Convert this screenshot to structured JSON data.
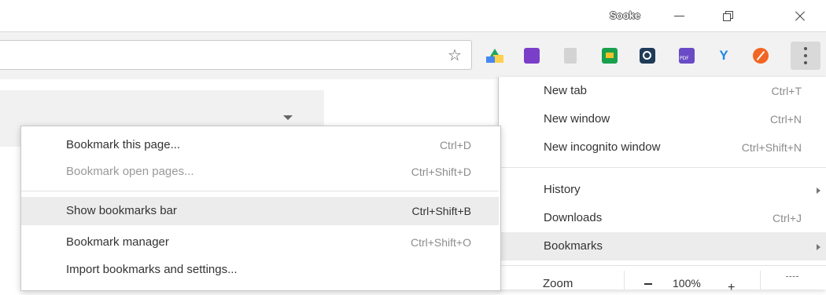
{
  "window": {
    "profile_name": "Sooke"
  },
  "toolbar": {
    "extensions": [
      "google-drive-icon",
      "puzzle-extension-icon",
      "grey-extension-icon",
      "google-classroom-icon",
      "camera-extension-icon",
      "pdf-extension-icon",
      "y-extension-icon",
      "orange-extension-icon"
    ]
  },
  "main_menu": {
    "items": [
      {
        "label": "New tab",
        "shortcut": "Ctrl+T"
      },
      {
        "label": "New window",
        "shortcut": "Ctrl+N"
      },
      {
        "label": "New incognito window",
        "shortcut": "Ctrl+Shift+N"
      },
      {
        "label": "History",
        "shortcut": ""
      },
      {
        "label": "Downloads",
        "shortcut": "Ctrl+J"
      },
      {
        "label": "Bookmarks",
        "shortcut": ""
      }
    ],
    "zoom": {
      "label": "Zoom",
      "value": "100%",
      "minus": "−",
      "plus": "+"
    }
  },
  "bookmarks_menu": {
    "items": [
      {
        "label": "Bookmark this page...",
        "shortcut": "Ctrl+D"
      },
      {
        "label": "Bookmark open pages...",
        "shortcut": "Ctrl+Shift+D"
      },
      {
        "label": "Show bookmarks bar",
        "shortcut": "Ctrl+Shift+B"
      },
      {
        "label": "Bookmark manager",
        "shortcut": "Ctrl+Shift+O"
      },
      {
        "label": "Import bookmarks and settings...",
        "shortcut": ""
      }
    ]
  },
  "colors": {
    "highlight": "#ececec",
    "menu_background": "#ffffff",
    "toolbar_background": "#f2f2f2"
  }
}
